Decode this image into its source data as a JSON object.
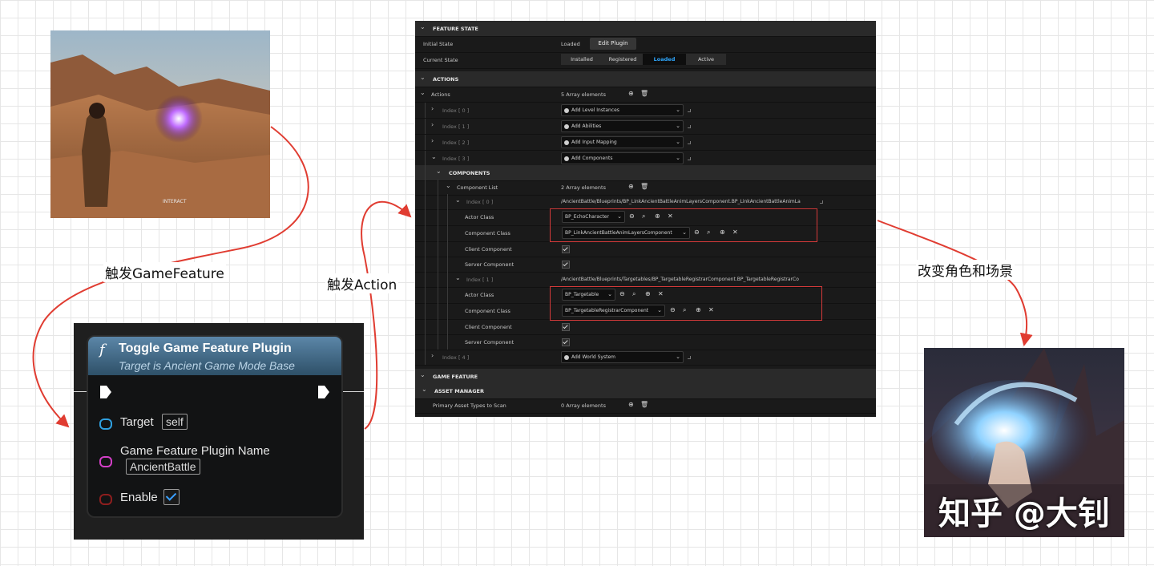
{
  "captions": {
    "trigger_game_feature": "触发GameFeature",
    "trigger_action": "触发Action",
    "change_scene": "改变角色和场景"
  },
  "scene_before": {
    "overlay_text": "INTERACT"
  },
  "scene_after": {
    "watermark": "知乎 @大钊"
  },
  "node": {
    "icon": "f",
    "title": "Toggle Game Feature Plugin",
    "subtitle": "Target is Ancient Game Mode Base",
    "target_label": "Target",
    "target_value": "self",
    "plugin_name_label": "Game Feature Plugin Name",
    "plugin_name_value": "AncientBattle",
    "enable_label": "Enable",
    "enable_checked": true
  },
  "panel": {
    "feature_state": {
      "header": "FEATURE STATE",
      "initial_state_label": "Initial State",
      "initial_state_value": "Loaded",
      "edit_plugin": "Edit Plugin",
      "current_state_label": "Current State",
      "states": [
        "Installed",
        "Registered",
        "Loaded",
        "Active"
      ],
      "active_state": "Loaded"
    },
    "actions": {
      "header": "ACTIONS",
      "label": "Actions",
      "count": "5 Array elements",
      "items": [
        {
          "index": "Index [ 0 ]",
          "value": "Add Level Instances"
        },
        {
          "index": "Index [ 1 ]",
          "value": "Add Abilities"
        },
        {
          "index": "Index [ 2 ]",
          "value": "Add Input Mapping"
        },
        {
          "index": "Index [ 3 ]",
          "value": "Add Components"
        },
        {
          "index": "Index [ 4 ]",
          "value": "Add World System"
        }
      ]
    },
    "components": {
      "header": "COMPONENTS",
      "list_label": "Component List",
      "list_count": "2 Array elements",
      "entries": [
        {
          "index": "Index [ 0 ]",
          "path": "/AncientBattle/Blueprints/BP_LinkAncientBattleAnimLayersComponent.BP_LinkAncientBattleAnimLa",
          "actor_class_label": "Actor Class",
          "actor_class": "BP_EchoCharacter",
          "component_class_label": "Component Class",
          "component_class": "BP_LinkAncientBattleAnimLayersComponent",
          "client_label": "Client Component",
          "server_label": "Server Component"
        },
        {
          "index": "Index [ 1 ]",
          "path": "/AncientBattle/Blueprints/Targetables/BP_TargetableRegistrarComponent.BP_TargetableRegistrarCo",
          "actor_class_label": "Actor Class",
          "actor_class": "BP_Targetable",
          "component_class_label": "Component Class",
          "component_class": "BP_TargetableRegistrarComponent",
          "client_label": "Client Component",
          "server_label": "Server Component"
        }
      ]
    },
    "game_feature": {
      "header": "GAME FEATURE"
    },
    "asset_manager": {
      "header": "ASSET MANAGER",
      "primary_label": "Primary Asset Types to Scan",
      "primary_count": "0 Array elements"
    }
  },
  "colors": {
    "arrow": "#e03c31",
    "highlight": "#d63a3a",
    "active_state": "#2fa8ff",
    "node_header": "#5b86a8"
  }
}
